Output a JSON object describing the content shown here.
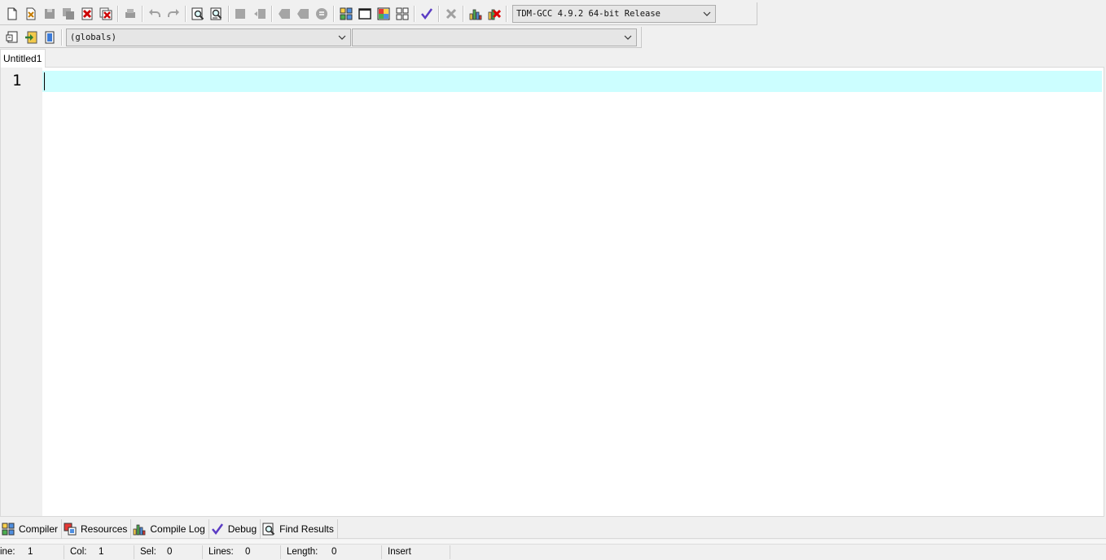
{
  "toolbar": {
    "buttons_row1": [
      {
        "name": "new-file-icon",
        "enabled": true
      },
      {
        "name": "open-project-icon",
        "enabled": true
      },
      {
        "name": "save-icon",
        "enabled": false
      },
      {
        "name": "save-all-icon",
        "enabled": false
      },
      {
        "name": "close-icon",
        "enabled": true
      },
      {
        "name": "close-all-icon",
        "enabled": true
      },
      {
        "name": "print-icon",
        "enabled": false
      },
      {
        "name": "undo-icon",
        "enabled": false
      },
      {
        "name": "redo-icon",
        "enabled": false
      },
      {
        "name": "find-icon",
        "enabled": true
      },
      {
        "name": "replace-icon",
        "enabled": true
      },
      {
        "name": "indent-icon",
        "enabled": false
      },
      {
        "name": "unindent-icon",
        "enabled": false
      },
      {
        "name": "bookmark-prev-icon",
        "enabled": false
      },
      {
        "name": "bookmark-next-icon",
        "enabled": false
      },
      {
        "name": "goto-line-icon",
        "enabled": false
      },
      {
        "name": "compile-icon",
        "enabled": true
      },
      {
        "name": "run-icon",
        "enabled": true
      },
      {
        "name": "compile-run-icon",
        "enabled": true
      },
      {
        "name": "rebuild-all-icon",
        "enabled": true
      },
      {
        "name": "syntax-check-icon",
        "enabled": true
      },
      {
        "name": "stop-execution-icon",
        "enabled": false
      },
      {
        "name": "profile-icon",
        "enabled": true
      },
      {
        "name": "delete-profile-icon",
        "enabled": true
      }
    ],
    "compiler_select": "TDM-GCC 4.9.2 64-bit Release",
    "buttons_row2": [
      {
        "name": "insert-icon"
      },
      {
        "name": "goto-declaration-icon"
      },
      {
        "name": "class-browser-icon"
      }
    ],
    "globals_select": "(globals)",
    "members_select": ""
  },
  "tabs": {
    "file_tab": "Untitled1"
  },
  "editor": {
    "line_numbers": [
      "1"
    ],
    "current_line_color": "#ccfeff",
    "content": ""
  },
  "panel_tabs": [
    {
      "label": "Compiler",
      "icon": "compiler-grid-icon"
    },
    {
      "label": "Resources",
      "icon": "resources-icon"
    },
    {
      "label": "Compile Log",
      "icon": "compile-log-chart-icon"
    },
    {
      "label": "Debug",
      "icon": "debug-check-icon"
    },
    {
      "label": "Find Results",
      "icon": "find-results-icon"
    }
  ],
  "statusbar": {
    "line_label": "ine:",
    "line_value": "1",
    "col_label": "Col:",
    "col_value": "1",
    "sel_label": "Sel:",
    "sel_value": "0",
    "lines_label": "Lines:",
    "lines_value": "0",
    "length_label": "Length:",
    "length_value": "0",
    "mode": "Insert"
  }
}
